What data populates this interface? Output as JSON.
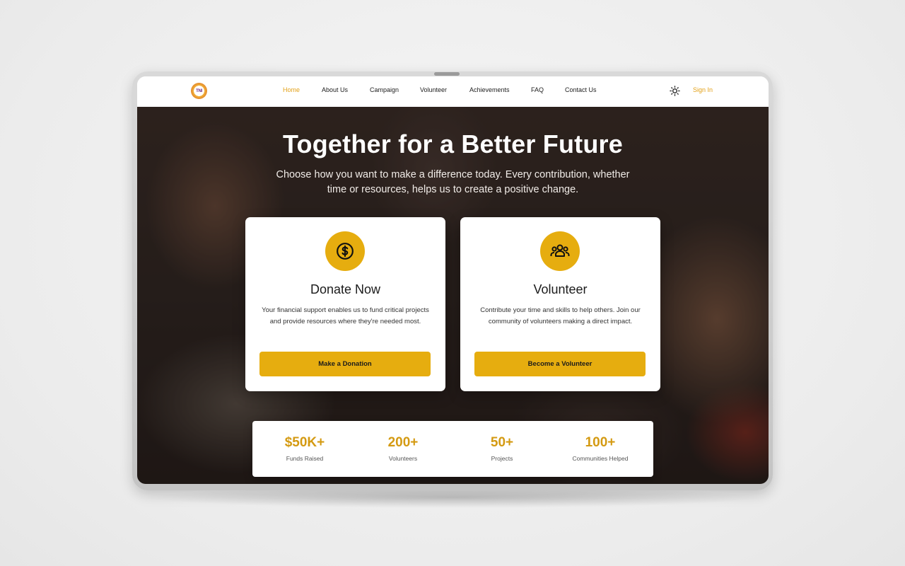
{
  "nav": {
    "logo_text": "TNI",
    "links": [
      "Home",
      "About Us",
      "Campaign",
      "Volunteer",
      "Achievements",
      "FAQ",
      "Contact Us"
    ],
    "active": "Home",
    "theme_icon": "sun-icon",
    "signin_label": "Sign In"
  },
  "hero": {
    "title": "Together for a Better Future",
    "subtitle": "Choose how you want to make a difference today. Every contribution, whether time or resources, helps us to create a positive change."
  },
  "cards": [
    {
      "icon": "dollar-icon",
      "title": "Donate Now",
      "text": "Your financial support enables us to fund critical projects and provide resources where they're needed most.",
      "button": "Make a Donation"
    },
    {
      "icon": "users-icon",
      "title": "Volunteer",
      "text": "Contribute your time and skills to help others. Join our community of volunteers making a direct impact.",
      "button": "Become a Volunteer"
    }
  ],
  "stats": [
    {
      "value": "$50K+",
      "label": "Funds Raised"
    },
    {
      "value": "200+",
      "label": "Volunteers"
    },
    {
      "value": "50+",
      "label": "Projects"
    },
    {
      "value": "100+",
      "label": "Communities Helped"
    }
  ],
  "colors": {
    "accent": "#e6ad0f",
    "accent_text": "#e3a21a",
    "stat_value": "#d49a12"
  }
}
